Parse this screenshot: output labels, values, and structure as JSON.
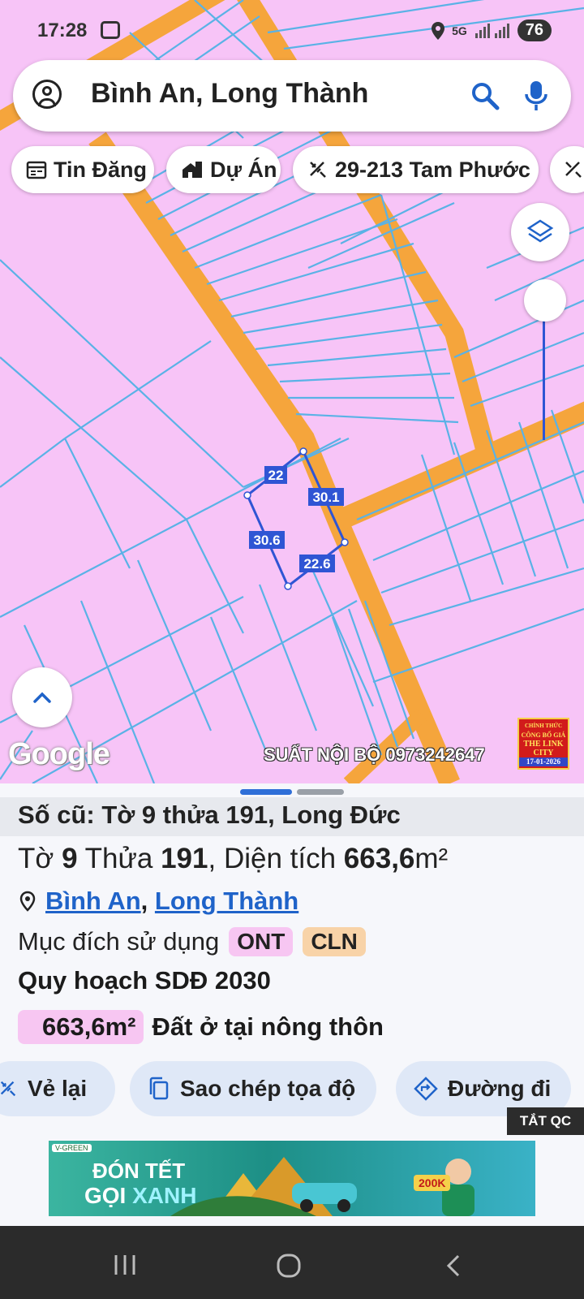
{
  "status": {
    "time": "17:28",
    "network": "5G",
    "battery": "76"
  },
  "search": {
    "query": "Bình An, Long Thành"
  },
  "chips": [
    {
      "label": "Tin Đăng",
      "icon": "calendar-icon"
    },
    {
      "label": "Dự Án",
      "icon": "building-icon"
    },
    {
      "label": "29-213 Tam Phước",
      "icon": "ruler-icon"
    }
  ],
  "map": {
    "measure_labels": [
      "22",
      "30.1",
      "30.6",
      "22.6"
    ],
    "google_label": "Google",
    "watermark": "SUẤT NỘI BỘ 0973242647",
    "seal_lines": [
      "CHÍNH THỨC",
      "CÔNG BỐ GIÁ",
      "THE LINK",
      "CITY",
      "17-01-2026"
    ],
    "colors": {
      "land": "#f7c4f7",
      "road": "#f5a53c",
      "parcel": "#5ab2e6",
      "selection": "#2f55d4"
    }
  },
  "sheet": {
    "old_ref": "Số cũ: Tờ 9 thửa 191, Long Đức",
    "lot": {
      "prefix1": "Tờ ",
      "sheet_no": "9",
      "prefix2": " Thửa ",
      "parcel_no": "191",
      "prefix3": ", Diện tích ",
      "area": "663,6",
      "unit": "m²"
    },
    "location": {
      "ward": "Bình An",
      "sep": ", ",
      "district": "Long Thành"
    },
    "purpose_label": "Mục đích sử dụng",
    "purpose_tags": [
      "ONT",
      "CLN"
    ],
    "plan_title": "Quy hoạch SDĐ 2030",
    "plan_area": "663,6m²",
    "plan_desc": "Đất ở tại nông thôn"
  },
  "actions": {
    "redraw": "Vẻ lại",
    "copy": "Sao chép tọa độ",
    "directions": "Đường đi"
  },
  "ad": {
    "hide_label": "TẮT QC",
    "line1": "ĐÓN TẾT",
    "line2a": "GỌI ",
    "line2b": "XANH",
    "price": "200K",
    "brand": "V-GREEN"
  }
}
